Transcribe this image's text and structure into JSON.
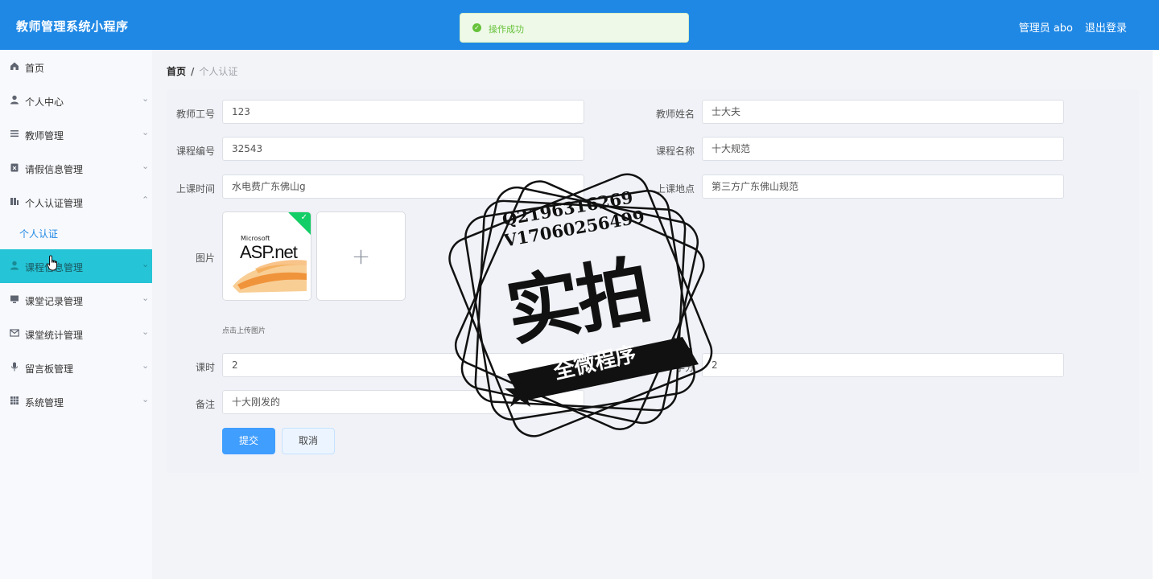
{
  "header": {
    "title": "教师管理系统小程序",
    "user": "管理员 abo",
    "logout": "退出登录"
  },
  "toast": {
    "message": "操作成功"
  },
  "sidebar": {
    "items": [
      {
        "label": "首页",
        "icon": "home-icon"
      },
      {
        "label": "个人中心",
        "icon": "user-icon"
      },
      {
        "label": "教师管理",
        "icon": "list-icon"
      },
      {
        "label": "请假信息管理",
        "icon": "clipboard-icon"
      },
      {
        "label": "个人认证管理",
        "icon": "chart-icon"
      },
      {
        "label": "课程信息管理",
        "icon": "user-icon"
      },
      {
        "label": "课堂记录管理",
        "icon": "monitor-icon"
      },
      {
        "label": "课堂统计管理",
        "icon": "mail-icon"
      },
      {
        "label": "留言板管理",
        "icon": "mic-icon"
      },
      {
        "label": "系统管理",
        "icon": "grid-icon"
      }
    ],
    "sub_item": "个人认证"
  },
  "breadcrumb": {
    "home": "首页",
    "sep": "/",
    "current": "个人认证"
  },
  "form": {
    "teacher_id": {
      "label": "教师工号",
      "value": "123"
    },
    "teacher_name": {
      "label": "教师姓名",
      "value": "士大夫"
    },
    "course_id": {
      "label": "课程编号",
      "value": "32543"
    },
    "course_name": {
      "label": "课程名称",
      "value": "十大规范"
    },
    "class_time": {
      "label": "上课时间",
      "value": "水电费广东佛山g"
    },
    "class_place": {
      "label": "上课地点",
      "value": "第三方广东佛山规范"
    },
    "image": {
      "label": "图片",
      "hint": "点击上传图片",
      "preview_brand_small": "Microsoft",
      "preview_brand": "ASP.net"
    },
    "hours": {
      "label": "课时",
      "value": "2"
    },
    "credit": {
      "label": "学分",
      "value": "2"
    },
    "remark": {
      "label": "备注",
      "value": "十大刚发的"
    },
    "submit": "提交",
    "cancel": "取消"
  },
  "watermark": {
    "line1": "Q2196316269",
    "line2": "V17060256499",
    "main": "实拍",
    "ribbon": "全微程序"
  },
  "colors": {
    "header": "#1f88e5",
    "active_menu": "#25c4d6",
    "primary": "#409eff",
    "success": "#67c23a"
  }
}
